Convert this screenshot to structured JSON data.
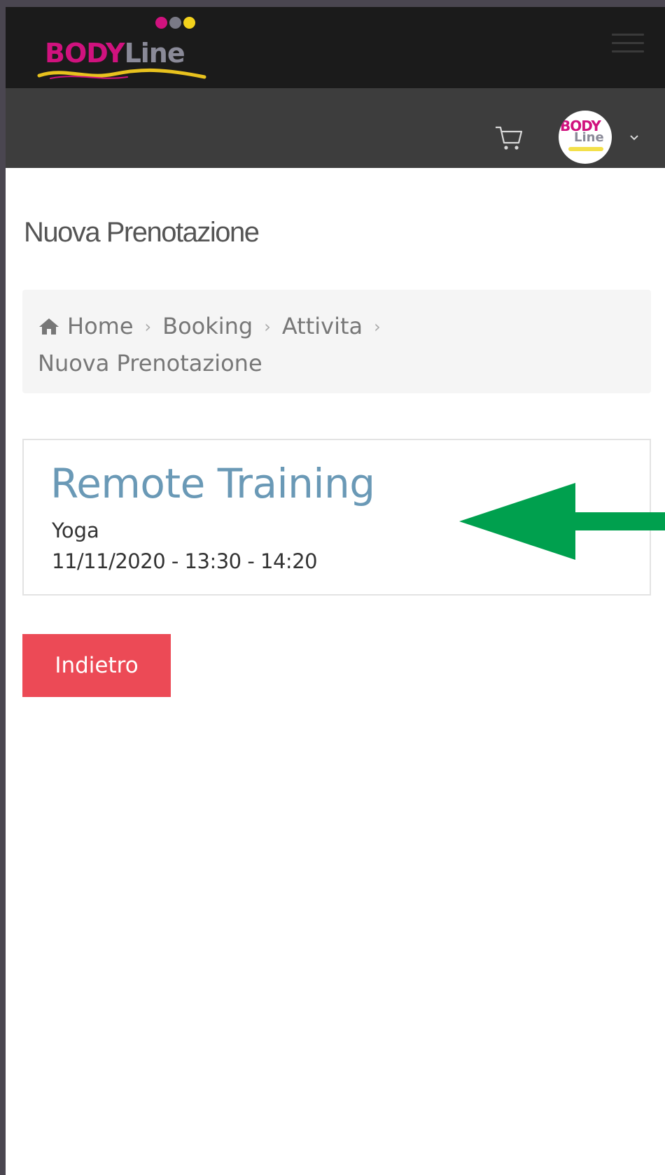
{
  "header": {
    "logo_text_body": "BODY",
    "logo_text_line": "Line",
    "logo_dot_colors": [
      "#d0127e",
      "#7a7a86",
      "#f3d21c"
    ],
    "menu_icon": "hamburger-menu-icon"
  },
  "userbar": {
    "cart_icon": "shopping-cart-icon",
    "avatar_text_body": "BODY",
    "avatar_text_line": "Line",
    "dropdown_icon": "chevron-down-icon"
  },
  "page": {
    "title": "Nuova Prenotazione"
  },
  "breadcrumb": {
    "items": [
      "Home",
      "Booking",
      "Attivita",
      "Nuova Prenotazione"
    ],
    "home_icon": "home-icon",
    "separator": "›"
  },
  "booking_card": {
    "title": "Remote Training",
    "activity": "Yoga",
    "datetime": "11/11/2020 - 13:30 - 14:20"
  },
  "annotation": {
    "arrow_color": "#00a04e",
    "arrow_icon": "arrow-left-icon"
  },
  "actions": {
    "back_label": "Indietro"
  },
  "colors": {
    "topbar": "#1b1b1b",
    "subbar": "#3d3d3d",
    "card_title": "#6a99b6",
    "back_button": "#ec4a56"
  }
}
